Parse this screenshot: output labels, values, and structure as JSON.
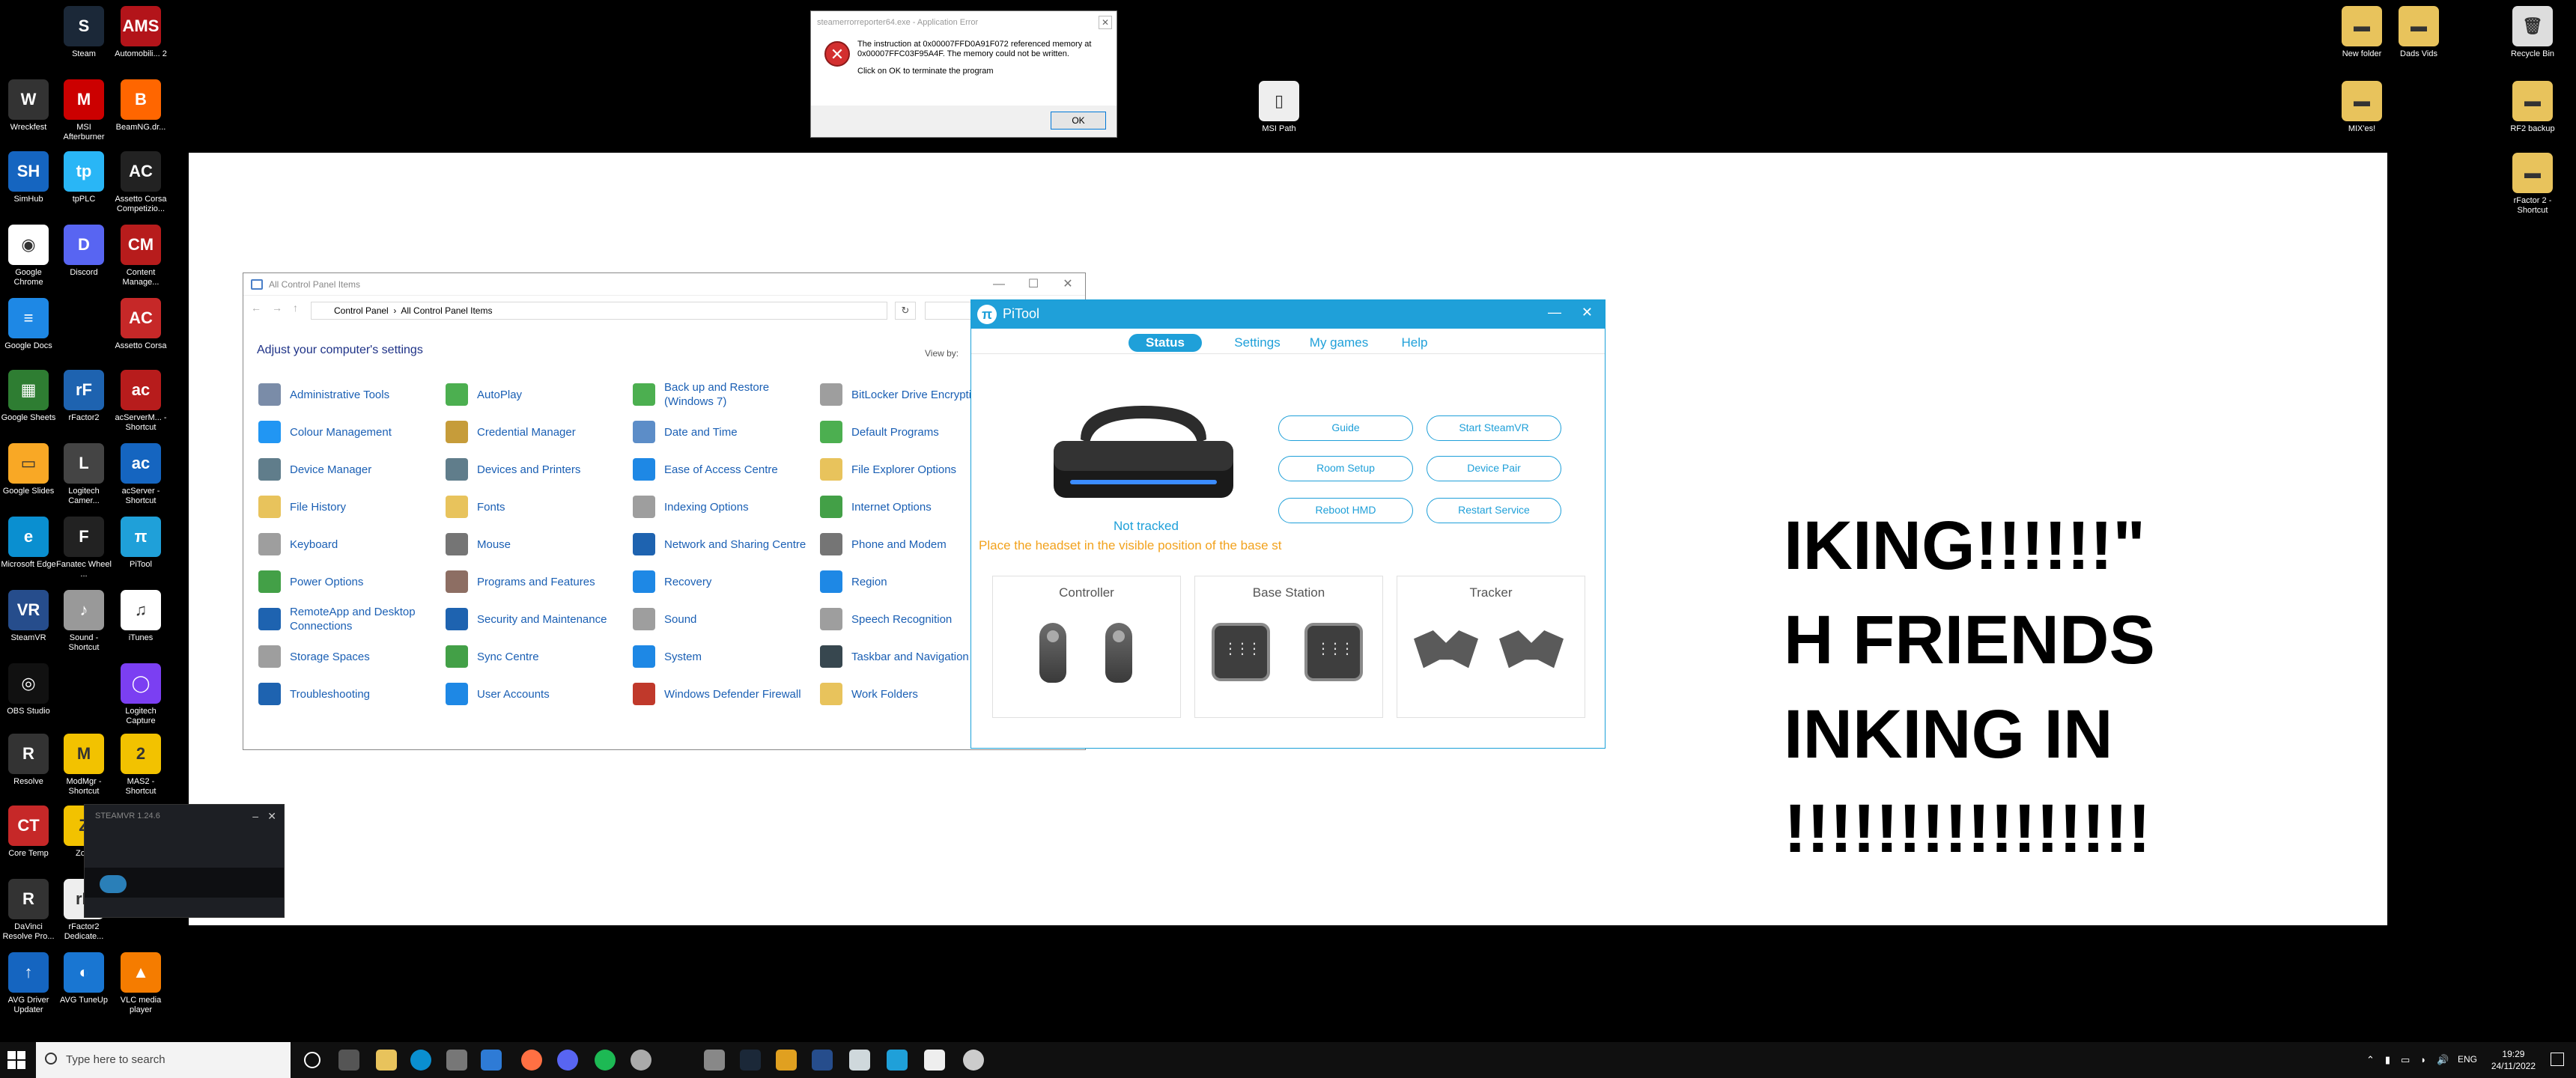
{
  "desktop_icons": [
    {
      "label": "Steam",
      "color": "#1b2838",
      "glyph": "S"
    },
    {
      "label": "Automobili... 2",
      "color": "#b3141a",
      "glyph": "AMS"
    },
    {
      "label": "Wreckfest",
      "color": "#333",
      "glyph": "W"
    },
    {
      "label": "MSI Afterburner",
      "color": "#c00",
      "glyph": "M"
    },
    {
      "label": "BeamNG.dr...",
      "color": "#f60",
      "glyph": "B"
    },
    {
      "label": "SimHub",
      "color": "#1565c0",
      "glyph": "SH"
    },
    {
      "label": "tpPLC",
      "color": "#29b6f6",
      "glyph": "tp"
    },
    {
      "label": "Assetto Corsa Competizio...",
      "color": "#222",
      "glyph": "AC"
    },
    {
      "label": "Google Chrome",
      "color": "#fff",
      "glyph": "◉"
    },
    {
      "label": "Discord",
      "color": "#5865f2",
      "glyph": "D"
    },
    {
      "label": "Content Manage...",
      "color": "#b71c1c",
      "glyph": "CM"
    },
    {
      "label": "Google Docs",
      "color": "#1e88e5",
      "glyph": "≡"
    },
    {
      "label": "Assetto Corsa",
      "color": "#c62828",
      "glyph": "AC"
    },
    {
      "label": "Google Sheets",
      "color": "#2e7d32",
      "glyph": "▦"
    },
    {
      "label": "rFactor2",
      "color": "#1e63b0",
      "glyph": "rF"
    },
    {
      "label": "acServerM... - Shortcut",
      "color": "#b71c1c",
      "glyph": "ac"
    },
    {
      "label": "Google Slides",
      "color": "#f9a825",
      "glyph": "▭"
    },
    {
      "label": "Logitech Camer...",
      "color": "#444",
      "glyph": "L"
    },
    {
      "label": "acServer - Shortcut",
      "color": "#1565c0",
      "glyph": "ac"
    },
    {
      "label": "Microsoft Edge",
      "color": "#0a8fd0",
      "glyph": "e"
    },
    {
      "label": "Fanatec Wheel ...",
      "color": "#222",
      "glyph": "F"
    },
    {
      "label": "PiTool",
      "color": "#1fa0d9",
      "glyph": "π"
    },
    {
      "label": "SteamVR",
      "color": "#264d8c",
      "glyph": "VR"
    },
    {
      "label": "Sound - Shortcut",
      "color": "#999",
      "glyph": "♪"
    },
    {
      "label": "iTunes",
      "color": "#fff",
      "glyph": "♫"
    },
    {
      "label": "OBS Studio",
      "color": "#111",
      "glyph": "◎"
    },
    {
      "label": "Logitech Capture",
      "color": "#7b3ff2",
      "glyph": "◯"
    },
    {
      "label": "Resolve",
      "color": "#333",
      "glyph": "R"
    },
    {
      "label": "ModMgr - Shortcut",
      "color": "#f2c200",
      "glyph": "M"
    },
    {
      "label": "MAS2 - Shortcut",
      "color": "#f2c200",
      "glyph": "2"
    },
    {
      "label": "Core Temp",
      "color": "#c62828",
      "glyph": "CT"
    },
    {
      "label": "Zo...",
      "color": "#f2c200",
      "glyph": "Z"
    },
    {
      "label": "DaVinci Resolve Pro...",
      "color": "#333",
      "glyph": "R"
    },
    {
      "label": "rFactor2 Dedicate...",
      "color": "#eee",
      "glyph": "rF"
    },
    {
      "label": "AVG Driver Updater",
      "color": "#1565c0",
      "glyph": "↑"
    },
    {
      "label": "AVG TuneUp",
      "color": "#1976d2",
      "glyph": "◐"
    },
    {
      "label": "VLC media player",
      "color": "#f57c00",
      "glyph": "▲"
    },
    {
      "label": "MSI Path",
      "color": "#eee",
      "glyph": "▯"
    },
    {
      "label": "New folder",
      "color": "#e8c35c",
      "glyph": "▬"
    },
    {
      "label": "Dads Vids",
      "color": "#e8c35c",
      "glyph": "▬"
    },
    {
      "label": "Recycle Bin",
      "color": "#ddd",
      "glyph": "🗑"
    },
    {
      "label": "MIX'es!",
      "color": "#e8c35c",
      "glyph": "▬"
    },
    {
      "label": "RF2 backup",
      "color": "#e8c35c",
      "glyph": "▬"
    },
    {
      "label": "rFactor 2 - Shortcut",
      "color": "#e8c35c",
      "glyph": "▬"
    }
  ],
  "background_text": [
    "IKING!!!!!!\"",
    "H FRIENDS",
    "INKING IN",
    "!!!!!!!!!!!!!!!!"
  ],
  "error_dialog": {
    "title": "steamerrorreporter64.exe - Application Error",
    "line1": "The instruction at 0x00007FFD0A91F072 referenced memory at 0x00007FFC03F95A4F. The memory could not be written.",
    "line2": "Click on OK to terminate the program",
    "ok": "OK"
  },
  "control_panel": {
    "title": "All Control Panel Items",
    "breadcrumb": [
      "Control Panel",
      "All Control Panel Items"
    ],
    "header": "Adjust your computer's settings",
    "view_by": "View by:",
    "items": [
      {
        "label": "Administrative Tools",
        "color": "#7a8ca8"
      },
      {
        "label": "AutoPlay",
        "color": "#4caf50"
      },
      {
        "label": "Back up and Restore (Windows 7)",
        "color": "#4caf50"
      },
      {
        "label": "BitLocker Drive Encryption",
        "color": "#9e9e9e"
      },
      {
        "label": "Colour Management",
        "color": "#2196f3"
      },
      {
        "label": "Credential Manager",
        "color": "#c69c3a"
      },
      {
        "label": "Date and Time",
        "color": "#5c8dc8"
      },
      {
        "label": "Default Programs",
        "color": "#4caf50"
      },
      {
        "label": "Device Manager",
        "color": "#607d8b"
      },
      {
        "label": "Devices and Printers",
        "color": "#607d8b"
      },
      {
        "label": "Ease of Access Centre",
        "color": "#1e88e5"
      },
      {
        "label": "File Explorer Options",
        "color": "#e8c35c"
      },
      {
        "label": "File History",
        "color": "#e8c35c"
      },
      {
        "label": "Fonts",
        "color": "#e8c35c"
      },
      {
        "label": "Indexing Options",
        "color": "#9e9e9e"
      },
      {
        "label": "Internet Options",
        "color": "#43a047"
      },
      {
        "label": "Keyboard",
        "color": "#9e9e9e"
      },
      {
        "label": "Mouse",
        "color": "#757575"
      },
      {
        "label": "Network and Sharing Centre",
        "color": "#1e63b0"
      },
      {
        "label": "Phone and Modem",
        "color": "#757575"
      },
      {
        "label": "Power Options",
        "color": "#43a047"
      },
      {
        "label": "Programs and Features",
        "color": "#8d6e63"
      },
      {
        "label": "Recovery",
        "color": "#1e88e5"
      },
      {
        "label": "Region",
        "color": "#1e88e5"
      },
      {
        "label": "RemoteApp and Desktop Connections",
        "color": "#1e63b0"
      },
      {
        "label": "Security and Maintenance",
        "color": "#1e63b0"
      },
      {
        "label": "Sound",
        "color": "#9e9e9e"
      },
      {
        "label": "Speech Recognition",
        "color": "#9e9e9e"
      },
      {
        "label": "Storage Spaces",
        "color": "#9e9e9e"
      },
      {
        "label": "Sync Centre",
        "color": "#43a047"
      },
      {
        "label": "System",
        "color": "#1e88e5"
      },
      {
        "label": "Taskbar and Navigation",
        "color": "#37474f"
      },
      {
        "label": "Troubleshooting",
        "color": "#1e63b0"
      },
      {
        "label": "User Accounts",
        "color": "#1e88e5"
      },
      {
        "label": "Windows Defender Firewall",
        "color": "#c0392b"
      },
      {
        "label": "Work Folders",
        "color": "#e8c35c"
      }
    ]
  },
  "pitool": {
    "title": "PiTool",
    "logo": "π",
    "tabs": [
      "Status",
      "Settings",
      "My games",
      "Help"
    ],
    "status": "Not tracked",
    "hint": "Place the headset in the visible position of the base st",
    "buttons": [
      "Guide",
      "Start SteamVR",
      "Room Setup",
      "Device Pair",
      "Reboot HMD",
      "Restart Service"
    ],
    "cards": [
      "Controller",
      "Base Station",
      "Tracker"
    ]
  },
  "steamvr": {
    "title": "STEAMVR 1.24.6"
  },
  "taskbar": {
    "search_placeholder": "Type here to search",
    "lang": "ENG",
    "time": "19:29",
    "date": "24/11/2022"
  }
}
